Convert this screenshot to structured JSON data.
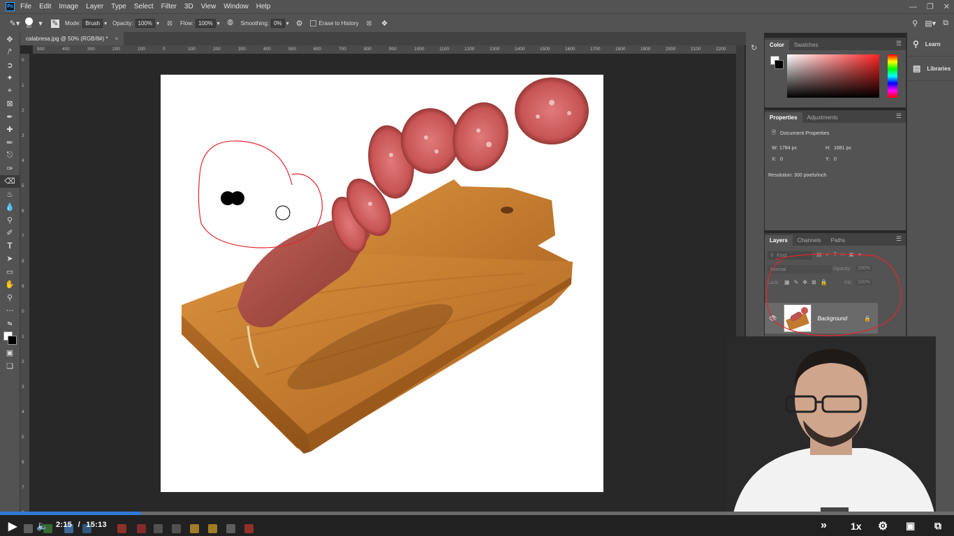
{
  "menubar": {
    "app_icon": "Ps",
    "items": [
      "File",
      "Edit",
      "Image",
      "Layer",
      "Type",
      "Select",
      "Filter",
      "3D",
      "View",
      "Window",
      "Help"
    ],
    "window_controls": [
      "minimize-icon",
      "restore-icon",
      "close-icon"
    ]
  },
  "options": {
    "brush_size": "60",
    "mode_label": "Mode:",
    "mode_value": "Brush",
    "opacity_label": "Opacity:",
    "opacity_value": "100%",
    "flow_label": "Flow:",
    "flow_value": "100%",
    "smoothing_label": "Smoothing:",
    "smoothing_value": "0%",
    "erase_history_label": "Erase to History"
  },
  "document": {
    "tab_title": "calabresa.jpg @ 50% (RGB/8#) *",
    "close_glyph": "×"
  },
  "ruler": {
    "h_ticks": [
      "500",
      "400",
      "300",
      "200",
      "100",
      "0",
      "100",
      "200",
      "300",
      "400",
      "500",
      "600",
      "700",
      "800",
      "900",
      "1000",
      "1100",
      "1200",
      "1300",
      "1400",
      "1500",
      "1600",
      "1700",
      "1800",
      "1900",
      "2000",
      "2100",
      "2200",
      "2"
    ],
    "v_ticks": [
      "0",
      "1",
      "2",
      "3",
      "4",
      "5",
      "6",
      "7",
      "8",
      "9",
      "0",
      "1",
      "2",
      "3",
      "4",
      "5",
      "6",
      "7",
      "8"
    ]
  },
  "color_panel": {
    "tabs": [
      "Color",
      "Swatches"
    ],
    "active_tab": "Color"
  },
  "properties_panel": {
    "tabs": [
      "Properties",
      "Adjustments"
    ],
    "active_tab": "Properties",
    "section_title": "Document Properties",
    "w_label": "W:",
    "w_value": "1784 px",
    "h_label": "H:",
    "h_value": "1681 px",
    "x_label": "X:",
    "x_value": "0",
    "y_label": "Y:",
    "y_value": "0",
    "resolution": "Resolution: 300 pixels/inch"
  },
  "layers_panel": {
    "tabs": [
      "Layers",
      "Channels",
      "Paths"
    ],
    "active_tab": "Layers",
    "filter_placeholder": "Kind",
    "blend_mode": "Normal",
    "opacity_label": "Opacity:",
    "opacity_value": "100%",
    "lock_label": "Lock:",
    "fill_label": "Fill:",
    "fill_value": "100%",
    "layers": [
      {
        "name": "Background",
        "visible": true,
        "locked": true
      }
    ]
  },
  "learn_panel": {
    "items": [
      {
        "label": "Learn",
        "icon": "lightbulb-icon"
      },
      {
        "label": "Libraries",
        "icon": "libraries-icon"
      }
    ]
  },
  "video": {
    "current_time": "2:15",
    "separator": "/",
    "duration": "15:13",
    "progress_fraction": 0.148,
    "speed": "1x",
    "colors": {
      "progress": "#2f7ad6",
      "annotation": "#e3262b"
    }
  }
}
